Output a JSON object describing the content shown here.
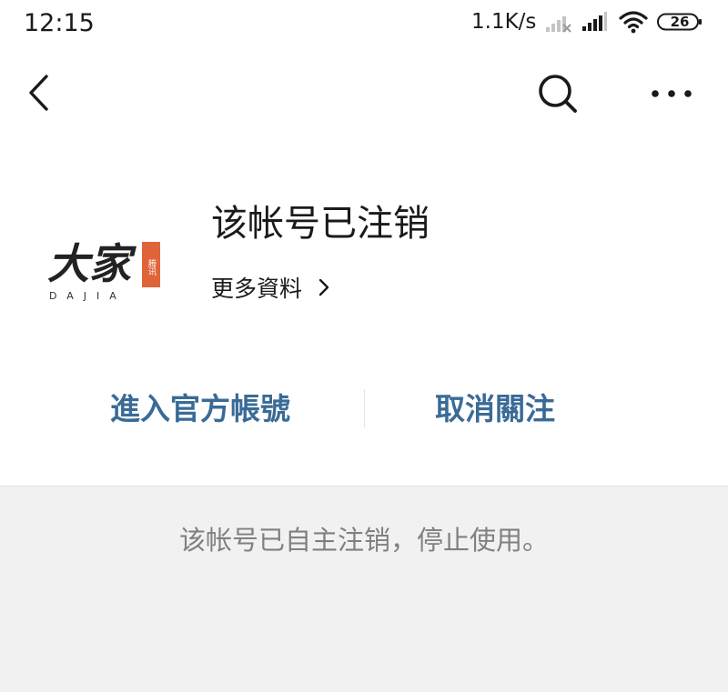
{
  "status_bar": {
    "time": "12:15",
    "network_speed": "1.1K/s",
    "battery_level": "26"
  },
  "nav": {
    "back_icon": "chevron-left-icon",
    "search_icon": "search-icon",
    "more_icon": "more-horizontal-icon"
  },
  "account": {
    "name": "该帐号已注销",
    "more_info_label": "更多資料",
    "logo_text": "大家",
    "logo_subtext": "DAJIA",
    "logo_seal_text": "腾讯",
    "logo_seal_color": "#e0643a"
  },
  "actions": {
    "enter_label": "進入官方帳號",
    "unfollow_label": "取消關注",
    "accent_color": "#3a6b96"
  },
  "notice": {
    "text": "该帐号已自主注销，停止使用。"
  }
}
